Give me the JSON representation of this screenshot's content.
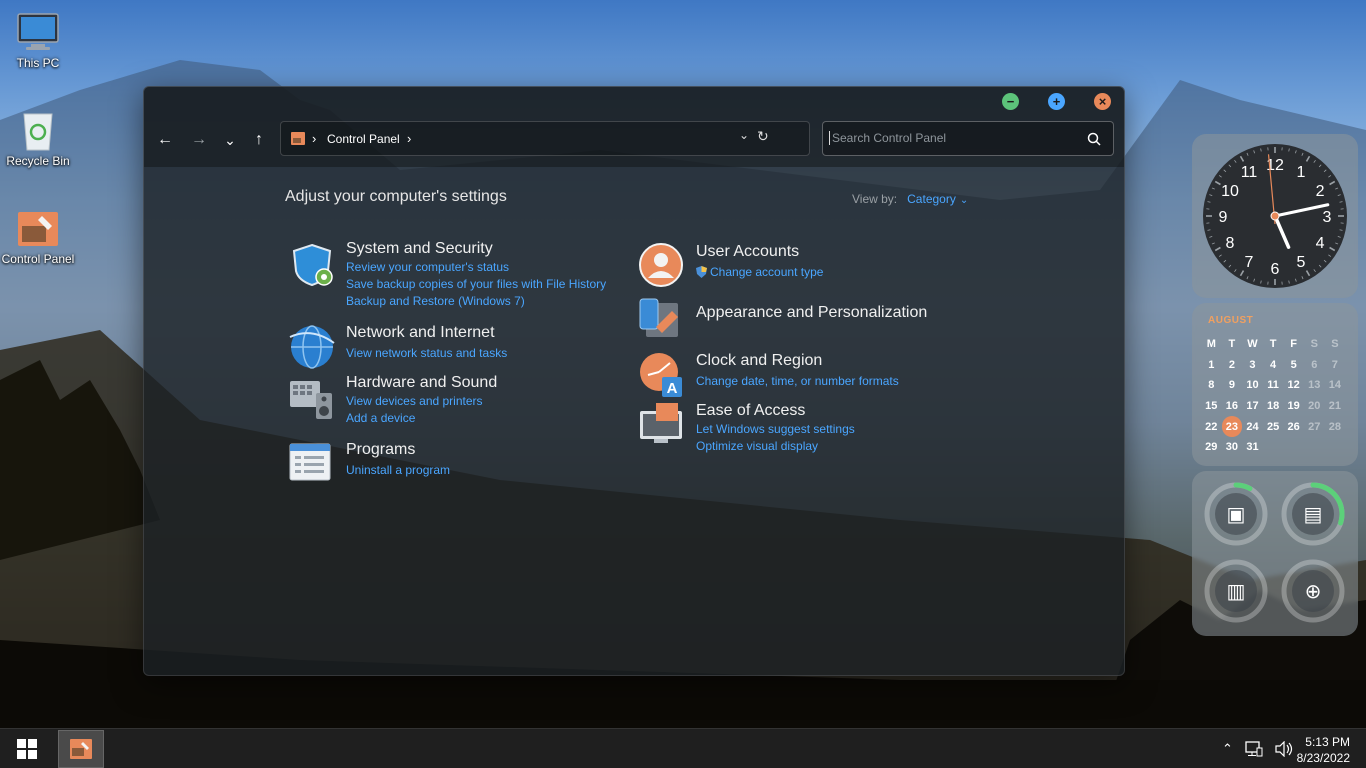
{
  "desktop": {
    "icons": [
      {
        "label": "This PC",
        "icon": "monitor-icon"
      },
      {
        "label": "Recycle Bin",
        "icon": "recycle-bin-icon"
      },
      {
        "label": "Control Panel",
        "icon": "control-panel-icon"
      }
    ]
  },
  "window": {
    "title_buttons": {
      "minimize": "−",
      "maximize": "+",
      "close": "×"
    },
    "nav": {
      "back": "←",
      "forward": "→",
      "recent": "⌄",
      "up": "↑"
    },
    "address": {
      "crumb": "Control Panel",
      "sep": "›"
    },
    "search": {
      "placeholder": "Search Control Panel"
    },
    "heading": "Adjust your computer's settings",
    "view_by": {
      "label": "View by:",
      "value": "Category"
    },
    "categories": [
      {
        "title": "System and Security",
        "icon": "shield-icon",
        "links": [
          "Review your computer's status",
          "Save backup copies of your files with File History",
          "Backup and Restore (Windows 7)"
        ]
      },
      {
        "title": "Network and Internet",
        "icon": "globe-icon",
        "links": [
          "View network status and tasks"
        ]
      },
      {
        "title": "Hardware and Sound",
        "icon": "printer-speaker-icon",
        "links": [
          "View devices and printers",
          "Add a device"
        ]
      },
      {
        "title": "Programs",
        "icon": "programs-icon",
        "links": [
          "Uninstall a program"
        ]
      },
      {
        "title": "User Accounts",
        "icon": "user-icon",
        "links": [
          "Change account type"
        ]
      },
      {
        "title": "Appearance and Personalization",
        "icon": "appearance-icon",
        "links": []
      },
      {
        "title": "Clock and Region",
        "icon": "clock-region-icon",
        "links": [
          "Change date, time, or number formats"
        ]
      },
      {
        "title": "Ease of Access",
        "icon": "ease-of-access-icon",
        "links": [
          "Let Windows suggest settings",
          "Optimize visual display"
        ]
      }
    ]
  },
  "widgets": {
    "clock": {
      "numbers": [
        "12",
        "1",
        "2",
        "3",
        "4",
        "5",
        "6",
        "7",
        "8",
        "9",
        "10",
        "11"
      ],
      "hour": 5,
      "minute": 13,
      "second": 59
    },
    "calendar": {
      "month": "AUGUST",
      "weekdays": [
        "M",
        "T",
        "W",
        "T",
        "F",
        "S",
        "S"
      ],
      "weeks": [
        [
          "1",
          "2",
          "3",
          "4",
          "5",
          "6",
          "7"
        ],
        [
          "8",
          "9",
          "10",
          "11",
          "12",
          "13",
          "14"
        ],
        [
          "15",
          "16",
          "17",
          "18",
          "19",
          "20",
          "21"
        ],
        [
          "22",
          "23",
          "24",
          "25",
          "26",
          "27",
          "28"
        ],
        [
          "29",
          "30",
          "31",
          "",
          "",
          "",
          ""
        ]
      ],
      "today": "23"
    },
    "monitors": [
      {
        "name": "cpu",
        "icon": "cpu-icon",
        "fraction": 0.08
      },
      {
        "name": "ram",
        "icon": "ram-icon",
        "fraction": 0.3
      },
      {
        "name": "disk",
        "icon": "disk-icon",
        "fraction": 0.0
      },
      {
        "name": "network",
        "icon": "network-globe-icon",
        "fraction": 0.0
      }
    ],
    "accent": "#5cd07a"
  },
  "taskbar": {
    "time": "5:13 PM",
    "date": "8/23/2022",
    "tray_icons": [
      "chevron-up-icon",
      "network-icon",
      "volume-icon"
    ]
  },
  "colors": {
    "link": "#4aa6ff",
    "minimize": "#5cc37a",
    "maximize": "#4aa6ff",
    "close": "#e8895a"
  }
}
